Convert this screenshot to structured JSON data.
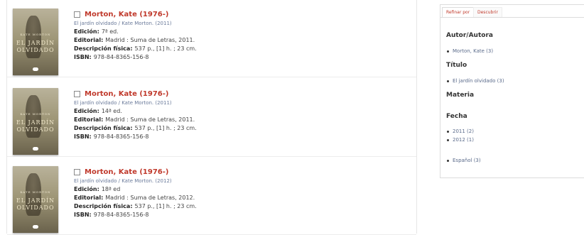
{
  "records": [
    {
      "title": "Morton, Kate (1976-)",
      "statement": "El jardín olvidado / Kate Morton. (2011)",
      "edicion_label": "Edición:",
      "edicion": "7ª ed.",
      "editorial_label": "Editorial:",
      "editorial": "Madrid : Suma de Letras, 2011.",
      "fisica_label": "Descripción física:",
      "fisica": "537 p., [1] h. ; 23 cm.",
      "isbn_label": "ISBN:",
      "isbn": "978-84-8365-156-8",
      "cover_author": "KATE MORTON",
      "cover_title1": "EL JARDÍN",
      "cover_title2": "OLVIDADO"
    },
    {
      "title": "Morton, Kate (1976-)",
      "statement": "El jardín olvidado / Kate Morton. (2011)",
      "edicion_label": "Edición:",
      "edicion": "14ª ed.",
      "editorial_label": "Editorial:",
      "editorial": "Madrid : Suma de Letras, 2011.",
      "fisica_label": "Descripción física:",
      "fisica": "537 p., [1] h. ; 23 cm.",
      "isbn_label": "ISBN:",
      "isbn": "978-84-8365-156-8",
      "cover_author": "KATE MORTON",
      "cover_title1": "EL JARDÍN",
      "cover_title2": "OLVIDADO"
    },
    {
      "title": "Morton, Kate (1976-)",
      "statement": "El jardín olvidado / Kate Morton. (2012)",
      "edicion_label": "Edición:",
      "edicion": "18ª ed",
      "editorial_label": "Editorial:",
      "editorial": "Madrid : Suma de Letras, 2012.",
      "fisica_label": "Descripción física:",
      "fisica": "537 p., [1] h. ; 23 cm.",
      "isbn_label": "ISBN:",
      "isbn": "978-84-8365-156-8",
      "cover_author": "KATE MORTON",
      "cover_title1": "EL JARDÍN",
      "cover_title2": "OLVIDADO"
    }
  ],
  "panel": {
    "tabs": [
      "Refinar por",
      "Descubrir"
    ],
    "facets": {
      "autor_head": "Autor/Autora",
      "autor_item": "Morton, Kate (3)",
      "titulo_head": "Título",
      "titulo_item": "El jardín olvidado (3)",
      "materia_head": "Materia",
      "fecha_head": "Fecha",
      "fecha_items": [
        "2011 (2)",
        "2012 (1)"
      ],
      "idioma_item": "Español (3)"
    }
  },
  "colors": {
    "accent": "#c0392b",
    "link": "#5a6a8a"
  }
}
